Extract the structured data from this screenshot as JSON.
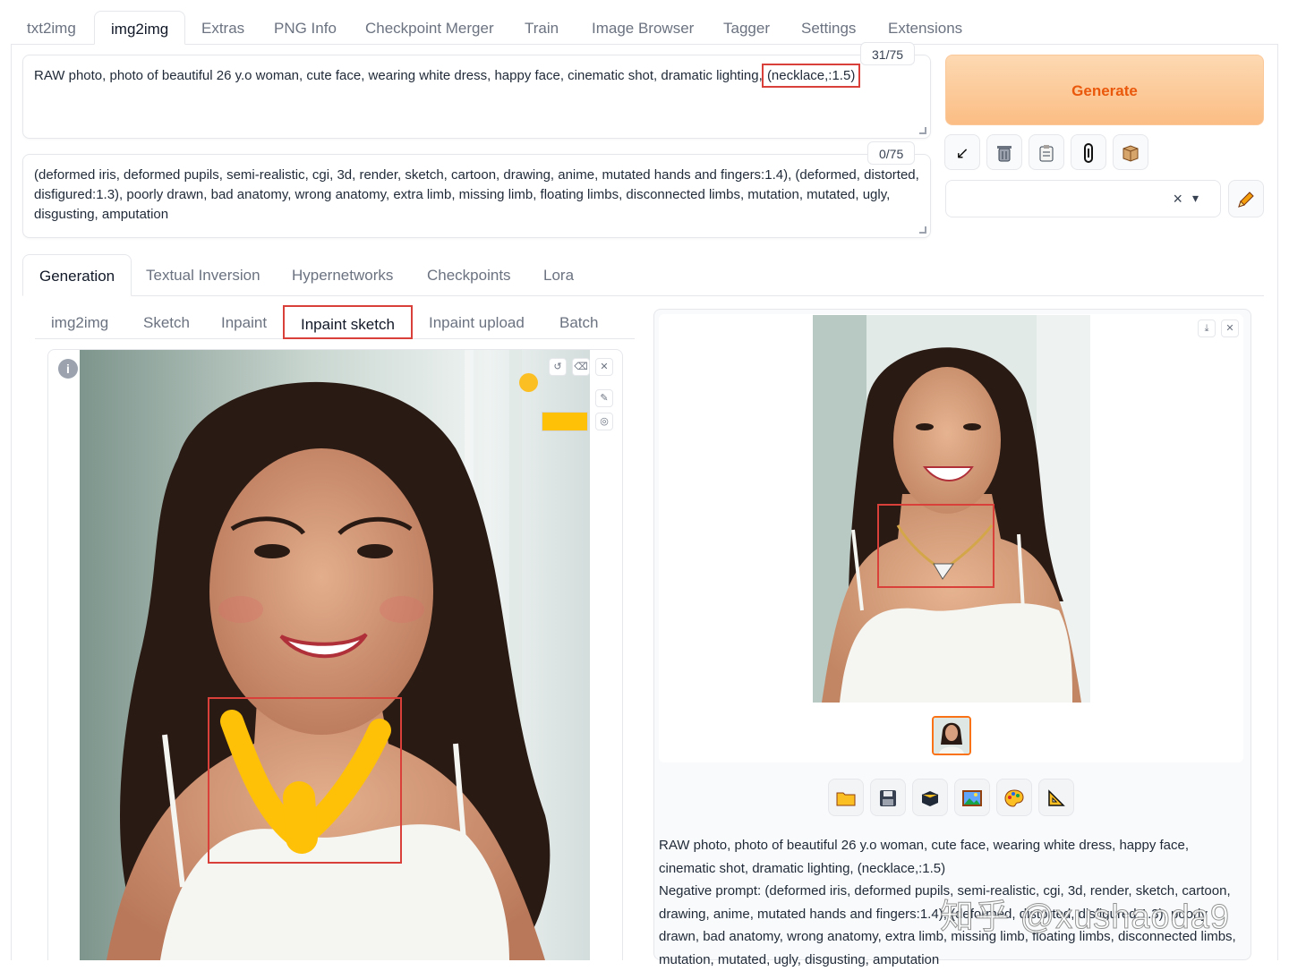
{
  "top_tabs": [
    "txt2img",
    "img2img",
    "Extras",
    "PNG Info",
    "Checkpoint Merger",
    "Train",
    "Image Browser",
    "Tagger",
    "Settings",
    "Extensions"
  ],
  "active_top_tab": "img2img",
  "prompt": {
    "text_before": "RAW photo, photo of beautiful 26 y.o woman, cute face, wearing white dress, happy face, cinematic shot, dramatic lighting, ",
    "highlight": "(necklace,:1.5)",
    "counter": "31/75"
  },
  "negative_prompt": {
    "text": "(deformed iris, deformed pupils, semi-realistic, cgi, 3d, render, sketch, cartoon, drawing, anime, mutated hands and fingers:1.4), (deformed, distorted, disfigured:1.3), poorly drawn, bad anatomy, wrong anatomy, extra limb, missing limb, floating limbs, disconnected limbs, mutation, mutated, ugly, disgusting, amputation",
    "counter": "0/75"
  },
  "generate_label": "Generate",
  "tool_buttons": [
    "arrow-icon",
    "trash-icon",
    "clipboard-icon",
    "paperclip-icon",
    "box-icon"
  ],
  "style_clear": "×",
  "style_caret": "▾",
  "generation_tabs": [
    "Generation",
    "Textual Inversion",
    "Hypernetworks",
    "Checkpoints",
    "Lora"
  ],
  "mode_tabs": [
    "img2img",
    "Sketch",
    "Inpaint",
    "Inpaint sketch",
    "Inpaint upload",
    "Batch"
  ],
  "brush_color": "#FFC107",
  "accent_red": "#D9403A",
  "output_action_icons": [
    "folder-icon",
    "save-icon",
    "zip-icon",
    "image-icon",
    "palette-icon",
    "ruler-icon"
  ],
  "info": {
    "line1": "RAW photo, photo of beautiful 26 y.o woman, cute face, wearing white dress, happy face, cinematic shot, dramatic lighting, (necklace,:1.5)",
    "line2": "Negative prompt: (deformed iris, deformed pupils, semi-realistic, cgi, 3d, render, sketch, cartoon, drawing, anime, mutated hands and fingers:1.4), (deformed, distorted, disfigured:1.3), poorly drawn, bad anatomy, wrong anatomy, extra limb, missing limb, floating limbs, disconnected limbs, mutation, mutated, ugly, disgusting, amputation"
  },
  "watermark": "知乎 @xushaoda9"
}
